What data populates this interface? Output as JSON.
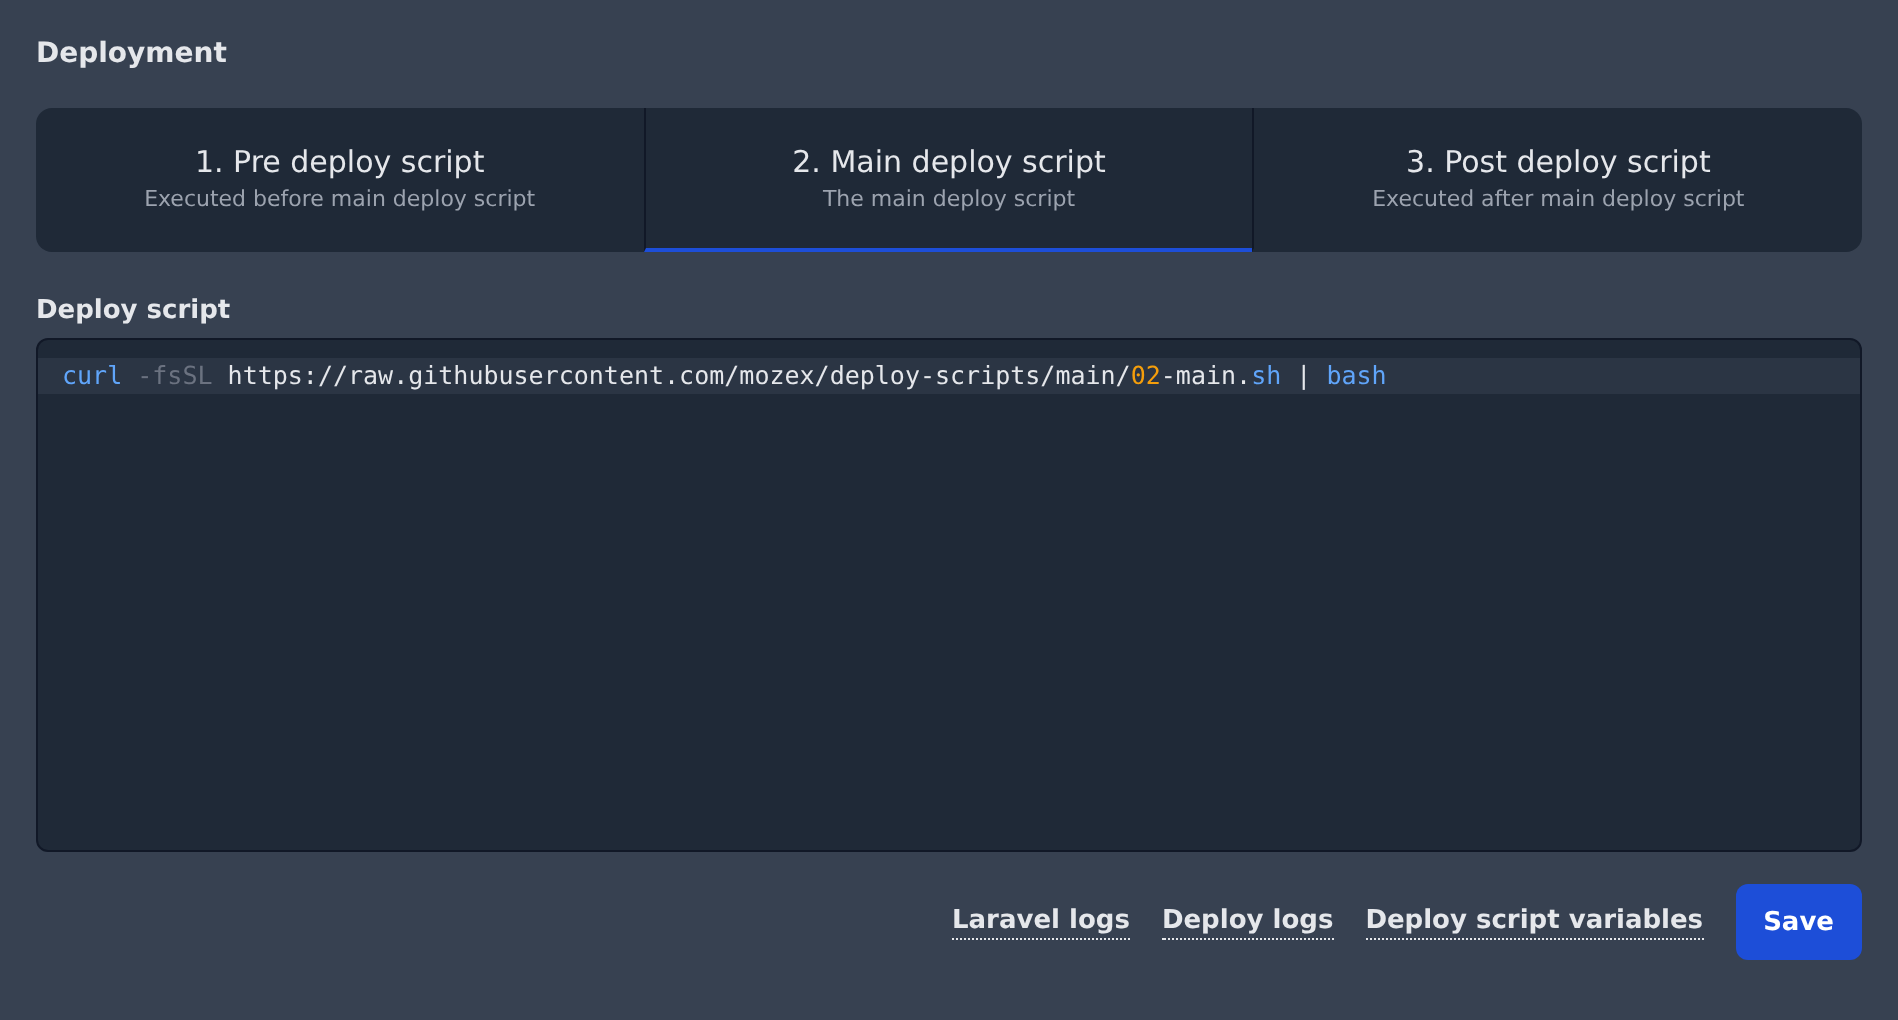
{
  "section_title": "Deployment",
  "tabs": [
    {
      "title": "1. Pre deploy script",
      "subtitle": "Executed before main deploy script",
      "selected": false
    },
    {
      "title": "2. Main deploy script",
      "subtitle": "The main deploy script",
      "selected": true
    },
    {
      "title": "3. Post deploy script",
      "subtitle": "Executed after main deploy script",
      "selected": false
    }
  ],
  "editor": {
    "label": "Deploy script",
    "lines": [
      {
        "active": true,
        "tokens": [
          {
            "kind": "keyword",
            "text": "curl"
          },
          {
            "kind": "option",
            "text": " -fsSL"
          },
          {
            "kind": "plain",
            "text": " https://raw.githubusercontent.com/mozex/deploy-scripts/main/"
          },
          {
            "kind": "number",
            "text": "02"
          },
          {
            "kind": "plain",
            "text": "-main."
          },
          {
            "kind": "keyword",
            "text": "sh"
          },
          {
            "kind": "plain",
            "text": " | "
          },
          {
            "kind": "keyword",
            "text": "bash"
          }
        ]
      }
    ]
  },
  "links": [
    "Laravel logs",
    "Deploy logs",
    "Deploy script variables"
  ],
  "save_button": "Save"
}
